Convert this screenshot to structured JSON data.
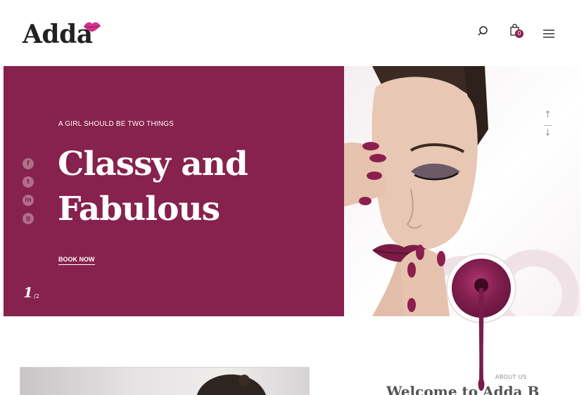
{
  "header": {
    "logo": "Adda",
    "cart_count": "0",
    "icons": {
      "search": "search-icon",
      "cart": "shopping-bag-icon",
      "menu": "hamburger-menu-icon"
    }
  },
  "hero": {
    "eyebrow": "A GIRL SHOULD BE TWO THINGS",
    "headline_line1": "Classy and",
    "headline_line2": "Fabulous",
    "cta": "BOOK NOW",
    "slide_current": "1",
    "slide_total": "2",
    "social": [
      "facebook-icon",
      "twitter-icon",
      "linkedin-icon",
      "google-plus-icon"
    ],
    "accent_color": "#87214d"
  },
  "about": {
    "label": "ABOUT US",
    "title": "Welcome to Adda B"
  }
}
